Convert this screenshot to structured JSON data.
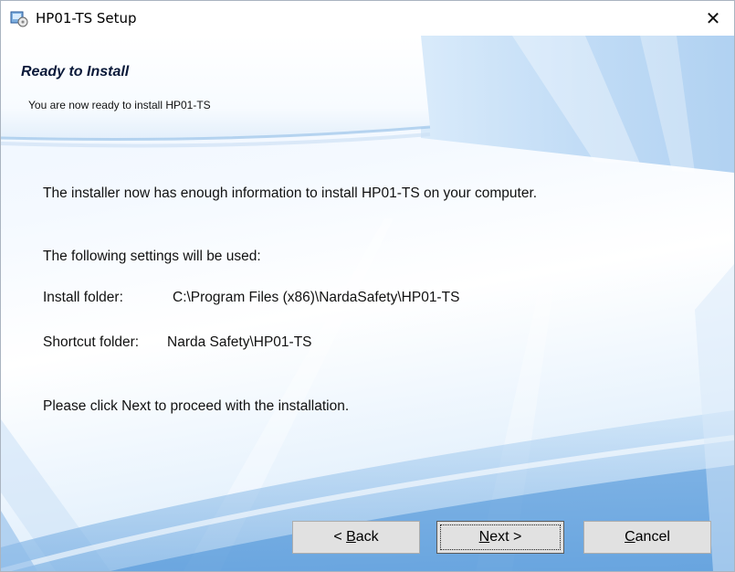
{
  "window": {
    "title": "HP01-TS Setup",
    "close_glyph": "✕"
  },
  "header": {
    "title": "Ready to Install",
    "subtitle": "You are now ready to install HP01-TS"
  },
  "body": {
    "intro": "The installer now has enough information to install HP01-TS on your computer.",
    "settings_heading": "The following settings will be used:",
    "install_folder_label": "Install folder:",
    "install_folder_value": "C:\\Program Files (x86)\\NardaSafety\\HP01-TS",
    "shortcut_folder_label": "Shortcut folder:",
    "shortcut_folder_value": "Narda Safety\\HP01-TS",
    "proceed_note": "Please click Next to proceed with the installation."
  },
  "buttons": {
    "back": {
      "prefix": "< ",
      "mnemonic": "B",
      "rest": "ack"
    },
    "next": {
      "prefix": "",
      "mnemonic": "N",
      "rest": "ext >"
    },
    "cancel": {
      "prefix": "",
      "mnemonic": "C",
      "rest": "ancel"
    }
  },
  "icons": {
    "app": "installer-icon",
    "close": "close-icon"
  }
}
